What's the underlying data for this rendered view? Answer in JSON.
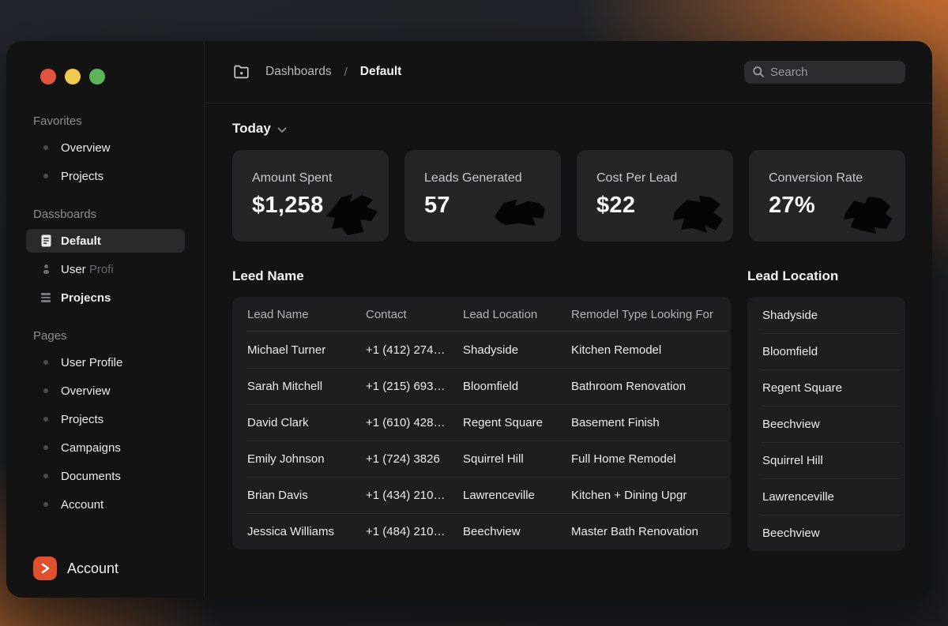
{
  "colors": {
    "accent_orange": "#df502d",
    "traffic_red": "#e2543e",
    "traffic_yellow": "#f0c94f",
    "traffic_green": "#5cb456",
    "backdrop_glow": "#d87430",
    "window_bg": "#131314",
    "card_bg": "#252528",
    "panel_bg": "#1e1e21"
  },
  "sidebar": {
    "favorites": {
      "label": "Favorites",
      "items": [
        "Overview",
        "Projects"
      ]
    },
    "dashboards": {
      "label": "Dassboards",
      "default_item": "Default",
      "user_item_primary": "User",
      "user_item_dim": "Profi",
      "projects_item": "Projecns"
    },
    "pages": {
      "label": "Pages",
      "items": [
        "User Profile",
        "Overview",
        "Projects",
        "Campaigns",
        "Documents",
        "Account"
      ]
    },
    "account_label": "Account"
  },
  "header": {
    "breadcrumb_parent": "Dashboards",
    "breadcrumb_separator": "/",
    "breadcrumb_current": "Default",
    "search_placeholder": "Search"
  },
  "main": {
    "period_label": "Today",
    "stats": [
      {
        "label": "Amount Spent",
        "value": "$1,258"
      },
      {
        "label": "Leads Generated",
        "value": "57"
      },
      {
        "label": "Cost Per Lead",
        "value": "$22"
      },
      {
        "label": "Conversion Rate",
        "value": "27%"
      }
    ],
    "table": {
      "title": "Leed Name",
      "columns": [
        "Lead Name",
        "Contact",
        "Lead Location",
        "Remodel Type Looking For"
      ],
      "rows": [
        [
          "Michael Turner",
          "+1 (412) 274…",
          "Shadyside",
          "Kitchen Remodel"
        ],
        [
          "Sarah Mitchell",
          "+1 (215) 693…",
          "Bloomfield",
          "Bathroom Renovation"
        ],
        [
          "David Clark",
          "+1 (610) 428…",
          "Regent Square",
          "Basement Finish"
        ],
        [
          "Emily Johnson",
          "+1 (724) 3826",
          "Squirrel Hill",
          "Full Home Remodel"
        ],
        [
          "Brian Davis",
          "+1 (434) 210…",
          "Lawrenceville",
          "Kitchen + Dining Upgr"
        ],
        [
          "Jessica Williams",
          "+1 (484) 210…",
          "Beechview",
          "Master Bath Renovation"
        ]
      ]
    },
    "locations": {
      "title": "Lead Location",
      "items": [
        "Shadyside",
        "Bloomfield",
        "Regent Square",
        "Beechview",
        "Squirrel Hill",
        "Lawrenceville",
        "Beechview"
      ]
    }
  }
}
